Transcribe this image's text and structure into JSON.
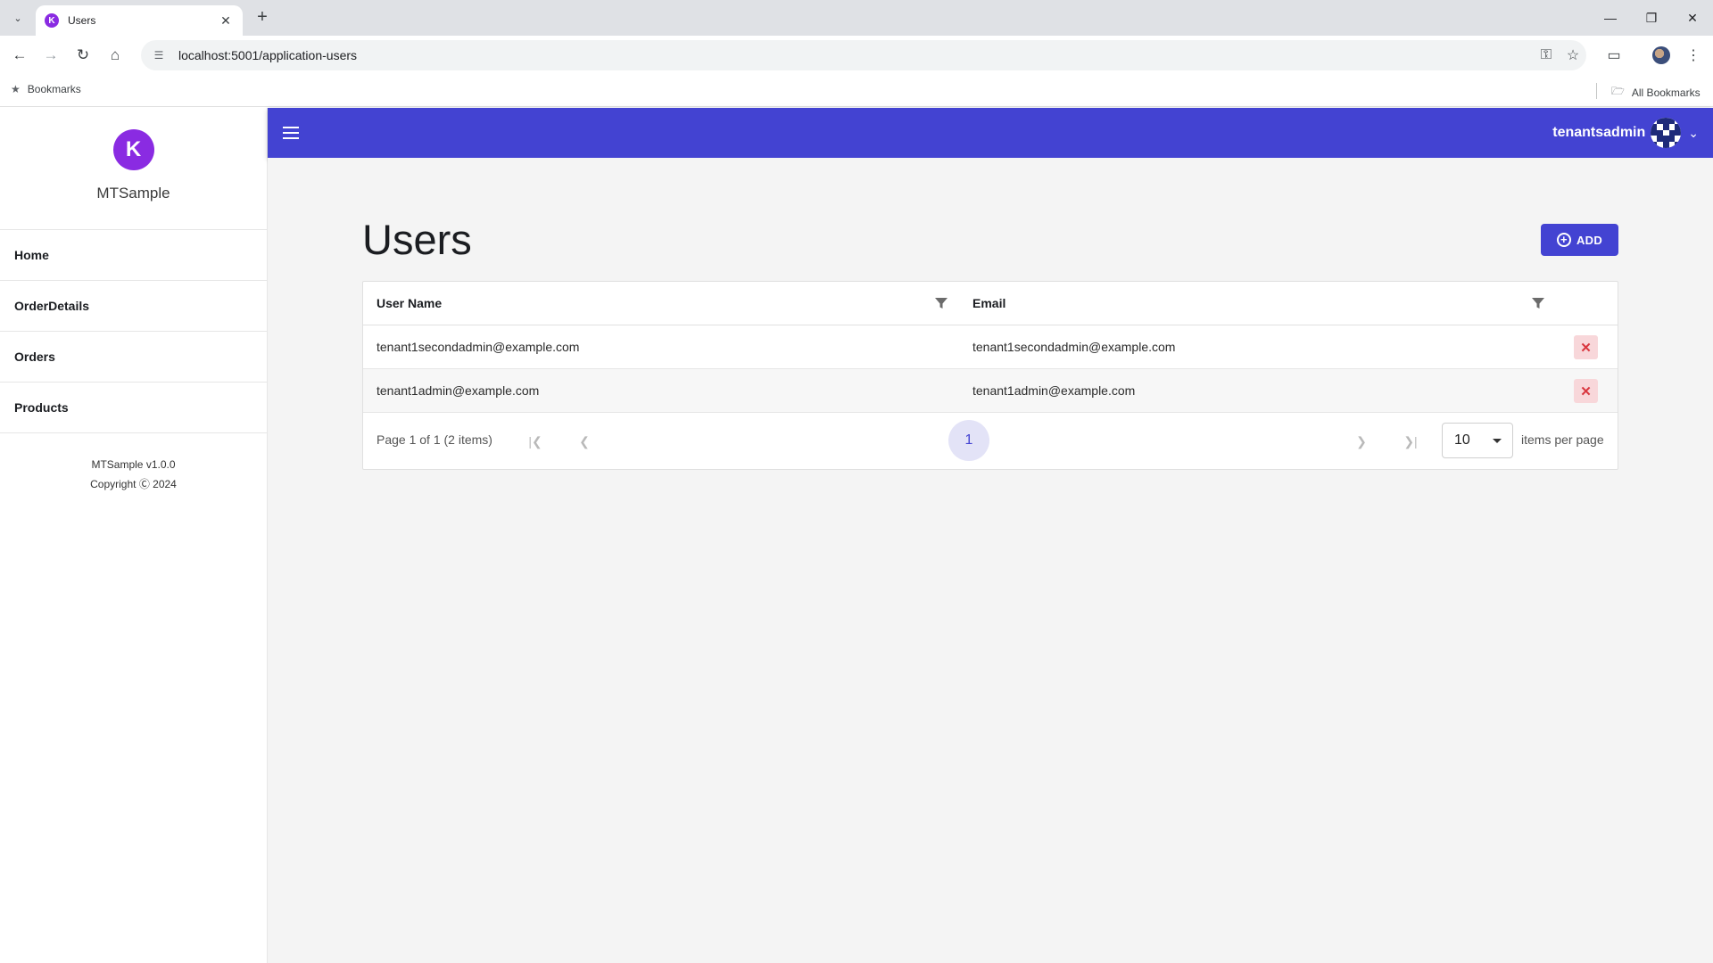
{
  "browser": {
    "tab_title": "Users",
    "tab_favicon_letter": "K",
    "url": "localhost:5001/application-users",
    "bookmarks_label": "Bookmarks",
    "all_bookmarks_label": "All Bookmarks"
  },
  "sidebar": {
    "brand_letter": "K",
    "brand_name": "MTSample",
    "items": [
      {
        "label": "Home"
      },
      {
        "label": "OrderDetails"
      },
      {
        "label": "Orders"
      },
      {
        "label": "Products"
      }
    ],
    "footer_version": "MTSample v1.0.0",
    "footer_copyright": "Copyright Ⓒ 2024"
  },
  "topbar": {
    "user_name": "tenantsadmin",
    "accent_color": "#4343d2"
  },
  "main": {
    "title": "Users",
    "add_label": "ADD",
    "grid": {
      "columns": [
        {
          "label": "User Name"
        },
        {
          "label": "Email"
        }
      ],
      "rows": [
        {
          "user_name": "tenant1secondadmin@example.com",
          "email": "tenant1secondadmin@example.com"
        },
        {
          "user_name": "tenant1admin@example.com",
          "email": "tenant1admin@example.com"
        }
      ],
      "pager": {
        "summary": "Page 1 of 1 (2 items)",
        "current_page": "1",
        "page_size": "10",
        "page_size_label": "items per page"
      }
    }
  },
  "icons": {
    "delete": "close-icon",
    "filter": "filter-icon",
    "menu": "hamburger-icon",
    "add": "plus-circle-icon"
  }
}
